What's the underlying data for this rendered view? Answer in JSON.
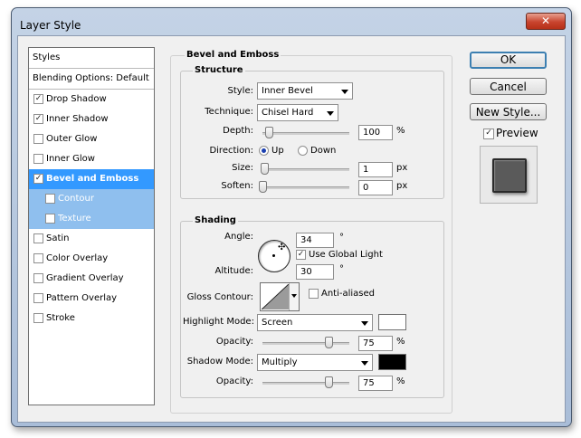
{
  "window": {
    "title": "Layer Style",
    "close_glyph": "✕"
  },
  "styles_panel": {
    "header": "Styles",
    "blending": "Blending Options: Default",
    "items": [
      {
        "label": "Drop Shadow",
        "checked": true
      },
      {
        "label": "Inner Shadow",
        "checked": true
      },
      {
        "label": "Outer Glow",
        "checked": false
      },
      {
        "label": "Inner Glow",
        "checked": false
      },
      {
        "label": "Bevel and Emboss",
        "checked": true,
        "selected": true
      },
      {
        "label": "Contour",
        "checked": false,
        "sub": true
      },
      {
        "label": "Texture",
        "checked": false,
        "sub": true
      },
      {
        "label": "Satin",
        "checked": false
      },
      {
        "label": "Color Overlay",
        "checked": false
      },
      {
        "label": "Gradient Overlay",
        "checked": false
      },
      {
        "label": "Pattern Overlay",
        "checked": false
      },
      {
        "label": "Stroke",
        "checked": false
      }
    ]
  },
  "bevel": {
    "title": "Bevel and Emboss",
    "structure": {
      "title": "Structure",
      "style_label": "Style:",
      "style_value": "Inner Bevel",
      "technique_label": "Technique:",
      "technique_value": "Chisel Hard",
      "depth_label": "Depth:",
      "depth_value": "100",
      "depth_unit": "%",
      "direction_label": "Direction:",
      "up_label": "Up",
      "down_label": "Down",
      "size_label": "Size:",
      "size_value": "1",
      "size_unit": "px",
      "soften_label": "Soften:",
      "soften_value": "0",
      "soften_unit": "px"
    },
    "shading": {
      "title": "Shading",
      "angle_label": "Angle:",
      "angle_value": "34",
      "angle_unit": "°",
      "global_light_label": "Use Global Light",
      "altitude_label": "Altitude:",
      "altitude_value": "30",
      "altitude_unit": "°",
      "gloss_contour_label": "Gloss Contour:",
      "anti_aliased_label": "Anti-aliased",
      "highlight_mode_label": "Highlight Mode:",
      "highlight_mode_value": "Screen",
      "highlight_color": "#ffffff",
      "highlight_opacity_label": "Opacity:",
      "highlight_opacity_value": "75",
      "highlight_opacity_unit": "%",
      "shadow_mode_label": "Shadow Mode:",
      "shadow_mode_value": "Multiply",
      "shadow_color": "#000000",
      "shadow_opacity_label": "Opacity:",
      "shadow_opacity_value": "75",
      "shadow_opacity_unit": "%"
    }
  },
  "buttons": {
    "ok": "OK",
    "cancel": "Cancel",
    "new_style": "New Style...",
    "preview_label": "Preview"
  },
  "colors": {
    "selection": "#3399ff",
    "sub_selection": "#8fbfee"
  }
}
